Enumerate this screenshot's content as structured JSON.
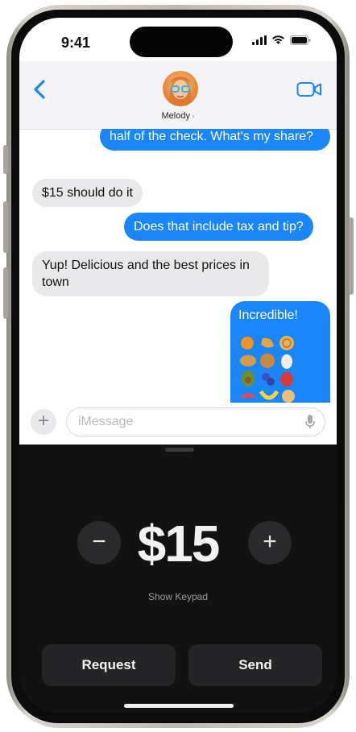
{
  "status_bar": {
    "time": "9:41"
  },
  "contact": {
    "name": "Melody"
  },
  "messages": [
    {
      "text": "half of the check. What's my share?",
      "direction": "outgoing"
    },
    {
      "text": "$15 should do it",
      "direction": "incoming"
    },
    {
      "text": "Does that include tax and tip?",
      "direction": "outgoing"
    },
    {
      "text": "Yup! Delicious and the best prices in town",
      "direction": "incoming"
    },
    {
      "text": "Incredible!",
      "direction": "outgoing",
      "attachment": "emoji-fruit-collage"
    }
  ],
  "composer": {
    "placeholder": "iMessage"
  },
  "payment": {
    "amount": "$15",
    "decrement_label": "−",
    "increment_label": "+",
    "keypad_label": "Show Keypad",
    "request_label": "Request",
    "send_label": "Send"
  },
  "colors": {
    "accent": "#1b86f7",
    "sheet_bg": "#121212",
    "incoming_bubble": "#e9e9eb"
  },
  "icons": [
    "back-icon",
    "video-call-icon",
    "add-icon",
    "microphone-icon",
    "signal-icon",
    "wifi-icon",
    "battery-icon"
  ]
}
